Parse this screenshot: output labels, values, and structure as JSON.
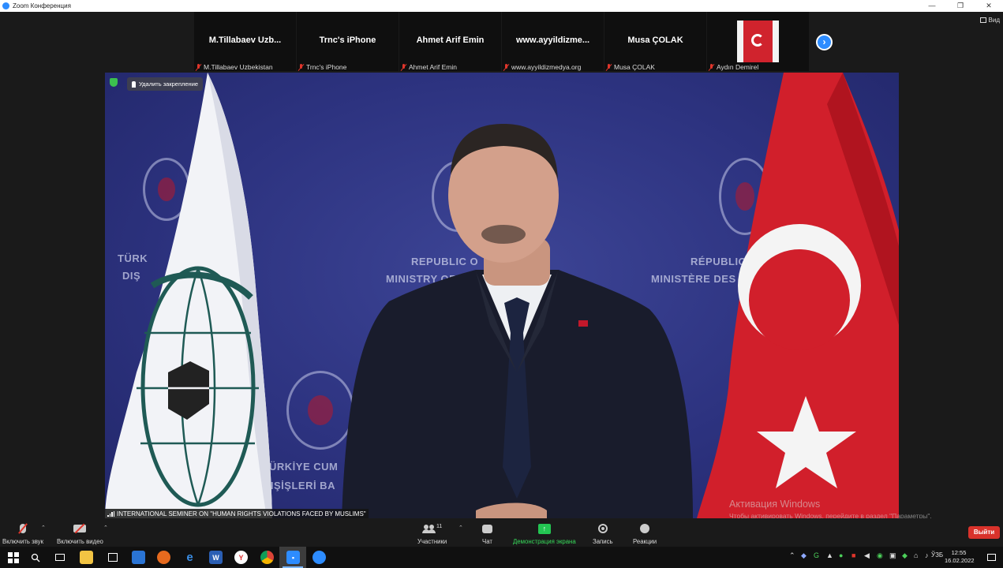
{
  "window": {
    "title": "Zoom Конференция",
    "controls": [
      "—",
      "❐",
      "✕"
    ]
  },
  "view_button": {
    "label": "Вид"
  },
  "participants_strip": [
    {
      "name": "M.Tillabaev  Uzb...",
      "footer": "M.Tillabaev Uzbekistan"
    },
    {
      "name": "Trnc's iPhone",
      "footer": "Trnc's iPhone"
    },
    {
      "name": "Ahmet Arif Emin",
      "footer": "Ahmet Arif Emin"
    },
    {
      "name": "www.ayyildizme...",
      "footer": "www.ayyildizmedya.org"
    },
    {
      "name": "Musa ÇOLAK",
      "footer": "Musa ÇOLAK"
    },
    {
      "name": "",
      "footer": "Aydın Demirel",
      "thumbnail": "turkish-flag"
    }
  ],
  "main_video": {
    "unpin_label": "Удалить закрепление",
    "speaker_caption": "INTERNATIONAL SEMINER ON \"HUMAN RIGHTS VIOLATIONS FACED BY MUSLIMS\"",
    "backdrop_text": {
      "en1": "REPUBLIC O",
      "en2": "MINISTRY OF",
      "fr1": "RÉPUBLIQ",
      "fr2": "MINISTÈRE DES A",
      "tr1": "TÜRK",
      "tr2": "DIŞ",
      "tr3": "ÜRKİYE CUM",
      "tr4": "DIŞİŞLERİ BA"
    }
  },
  "activation_notice": {
    "title": "Активация Windows",
    "subtitle": "Чтобы активировать Windows, перейдите в раздел \"Параметры\"."
  },
  "toolbar": {
    "unmute_label": "Включить звук",
    "start_video_label": "Включить видео",
    "participants_label": "Участники",
    "participants_count": "11",
    "chat_label": "Чат",
    "share_label": "Демонстрация экрана",
    "record_label": "Запись",
    "reactions_label": "Реакции",
    "leave_label": "Выйти",
    "share_color": "#23c552",
    "leave_color": "#d9322b"
  },
  "taskbar": {
    "apps": [
      "start",
      "search-icon",
      "task-view-icon",
      "file-explorer-icon",
      "store-icon",
      "mail-icon",
      "firefox-icon",
      "edge-icon",
      "word-icon",
      "yandex-icon",
      "chrome-icon",
      "zoom-icon",
      "app-icon"
    ],
    "language": "ЎЗБ",
    "time": "12:55",
    "date": "16.02.2022"
  }
}
